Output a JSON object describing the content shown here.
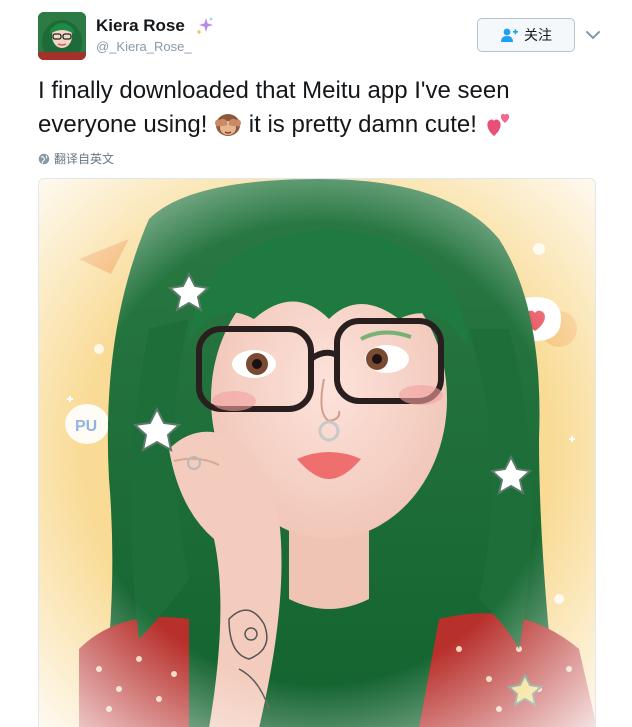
{
  "user": {
    "display_name": "Kiera Rose",
    "handle": "@_Kiera_Rose_",
    "badge_icon": "sparkles-icon"
  },
  "actions": {
    "follow_label": "关注",
    "follow_icon": "add-user-icon",
    "more_icon": "chevron-down-icon"
  },
  "tweet": {
    "text_part1": "I finally downloaded that Meitu app I've seen everyone using!",
    "emoji1": "see-no-evil-monkey-emoji",
    "text_part2": "it is pretty damn cute!",
    "emoji2": "two-hearts-emoji",
    "translate_label": "翻译自英文",
    "translate_icon": "globe-icon"
  },
  "media": {
    "description_icon": "photo",
    "sticker_text": "PU"
  },
  "colors": {
    "text": "#14171a",
    "muted": "#8899a6",
    "hair": "#1f7a3f",
    "background": "#fbe2a8"
  }
}
